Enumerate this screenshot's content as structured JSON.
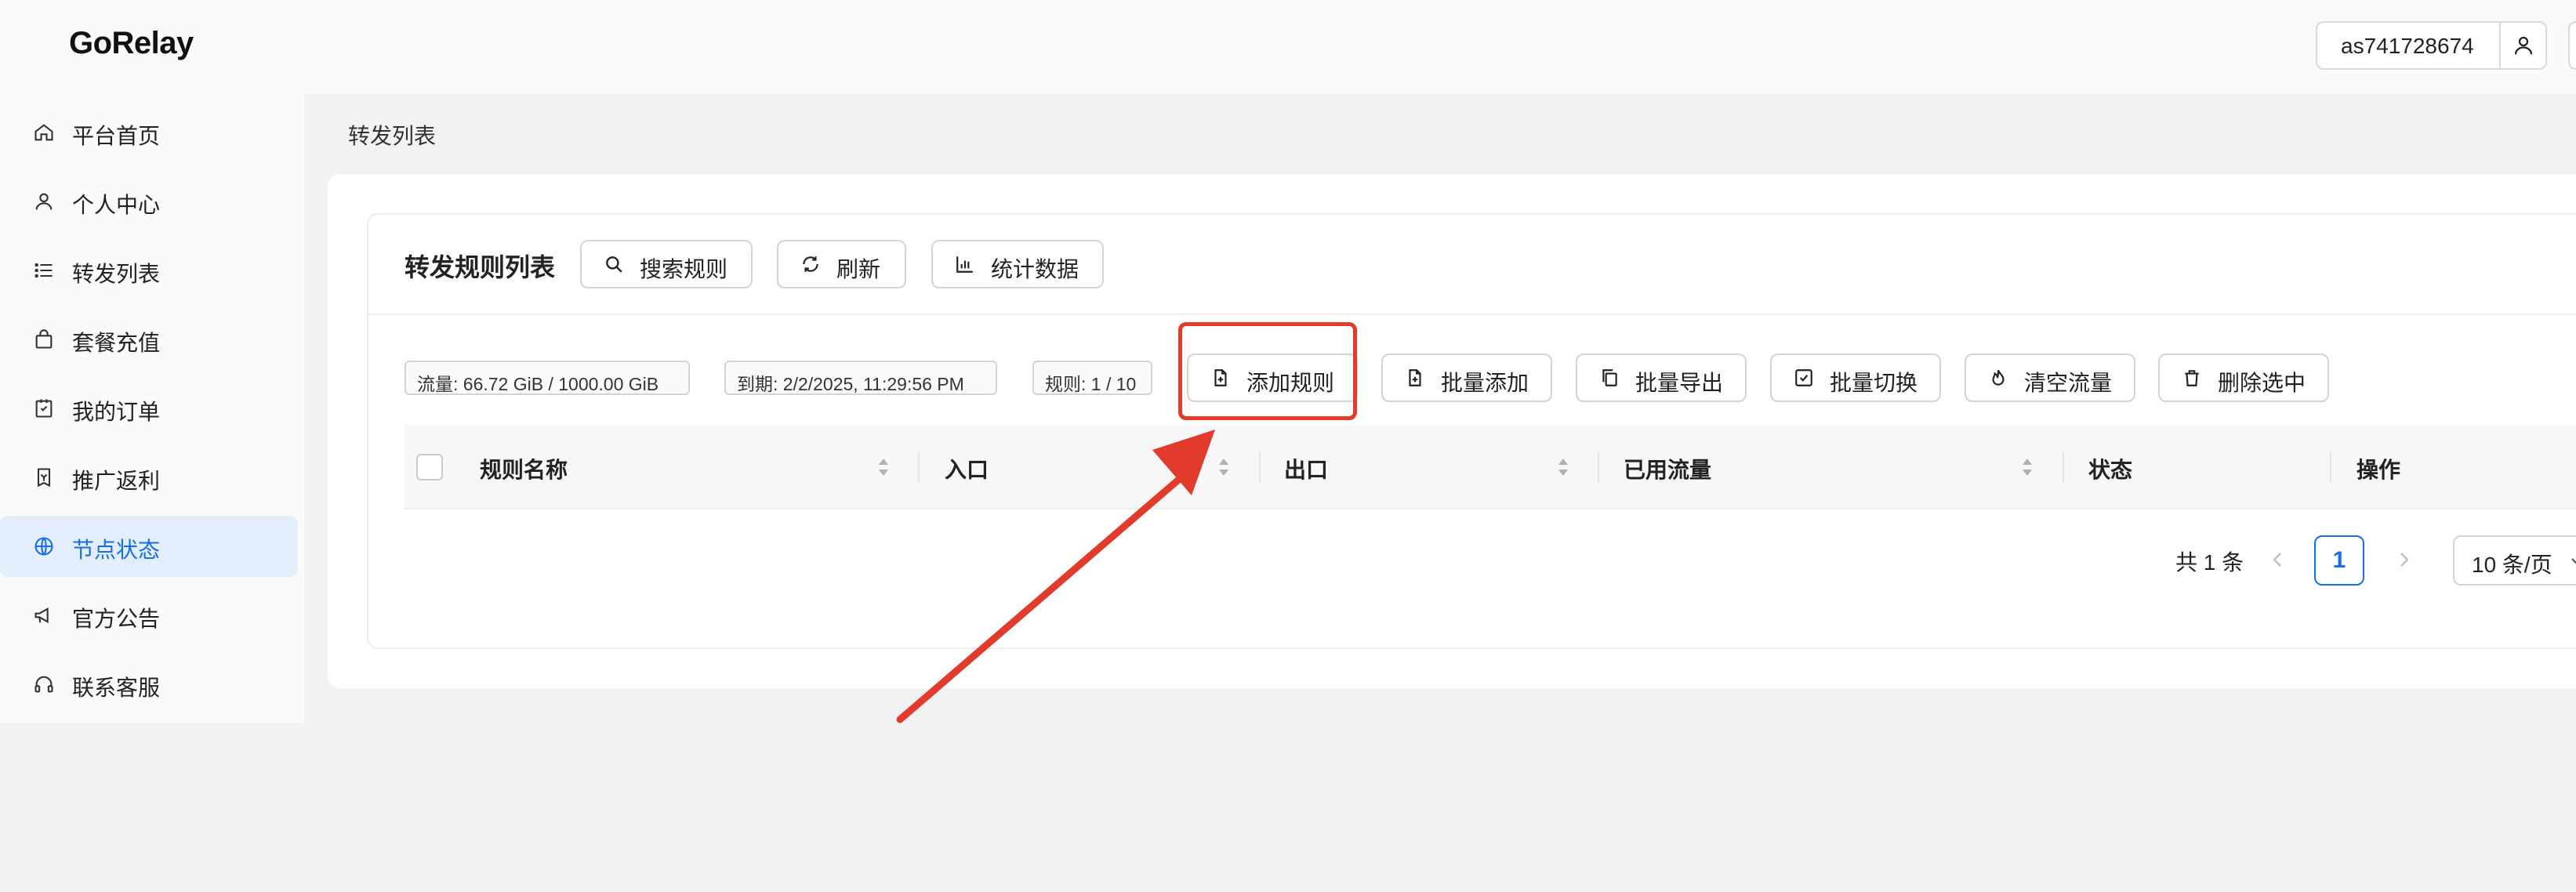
{
  "app": {
    "brand": "GoRelay"
  },
  "header": {
    "username": "as741728674",
    "user_icon": "user-icon"
  },
  "sidebar": {
    "items": [
      {
        "label": "平台首页",
        "icon": "home-icon"
      },
      {
        "label": "个人中心",
        "icon": "user-icon"
      },
      {
        "label": "转发列表",
        "icon": "list-icon"
      },
      {
        "label": "套餐充值",
        "icon": "bag-icon"
      },
      {
        "label": "我的订单",
        "icon": "order-icon"
      },
      {
        "label": "推广返利",
        "icon": "rebate-icon"
      },
      {
        "label": "节点状态",
        "icon": "globe-icon",
        "active": true
      },
      {
        "label": "官方公告",
        "icon": "megaphone-icon"
      },
      {
        "label": "联系客服",
        "icon": "headset-icon"
      }
    ]
  },
  "breadcrumb": "转发列表",
  "card": {
    "title": "转发规则列表",
    "toolbar": {
      "search": "搜索规则",
      "refresh": "刷新",
      "stats": "统计数据"
    }
  },
  "info": {
    "traffic": "流量: 66.72 GiB / 1000.00 GiB",
    "expiry": "到期: 2/2/2025, 11:29:56 PM",
    "rules": "规则: 1 / 10"
  },
  "actions": {
    "add": "添加规则",
    "batch_add": "批量添加",
    "batch_export": "批量导出",
    "batch_switch": "批量切换",
    "clear_traffic": "清空流量",
    "delete_selected": "删除选中"
  },
  "table": {
    "columns": [
      "规则名称",
      "入口",
      "出口",
      "已用流量",
      "状态",
      "操作"
    ],
    "rows": []
  },
  "pagination": {
    "total": "共 1 条",
    "current": "1",
    "page_size": "10 条/页"
  },
  "colors": {
    "accent": "#1a6fe0",
    "active_bg": "#e3eefc",
    "annotation": "#e23a2b"
  }
}
